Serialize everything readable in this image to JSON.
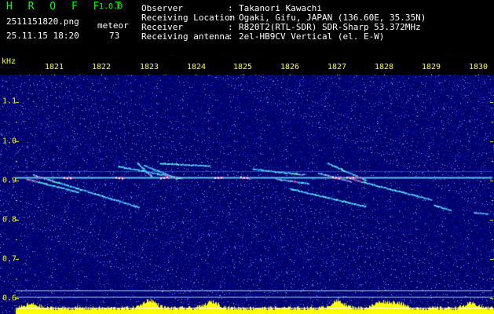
{
  "header": {
    "app_name": "H R O F F T",
    "app_version": "1.0.0",
    "filename": "2511151820.png",
    "datetime": "25.11.15 18:20",
    "count_label": "meteor",
    "count_value": "73"
  },
  "metadata": [
    {
      "label": "Observer",
      "value": "Takanori Kawachi"
    },
    {
      "label": "Receiving Location",
      "value": "Ogaki, Gifu, JAPAN (136.60E, 35.35N)"
    },
    {
      "label": "Receiver",
      "value": "R820T2(RTL-SDR) SDR-Sharp 53.372MHz"
    },
    {
      "label": "Receiving antenna",
      "value": "2el-HB9CV Vertical (el. E-W)"
    }
  ],
  "colors": {
    "label_text": "#ffffff",
    "axis_text": "#ffff00",
    "brand": "#00ff00",
    "background": "#000080",
    "carrier": "#66ffee",
    "peak": "#ff3399"
  },
  "chart_data": {
    "type": "heatmap",
    "ylabel": "kHz",
    "x_ticks": [
      "1821",
      "1822",
      "1823",
      "1824",
      "1825",
      "1826",
      "1827",
      "1828",
      "1829",
      "1830"
    ],
    "y_ticks": [
      "1.1",
      "1.0",
      "0.9",
      "0.8",
      "0.7",
      "0.6"
    ],
    "ylim": [
      0.58,
      1.17
    ],
    "xlim": [
      1820.5,
      1830.2
    ],
    "carrier_khz": 0.907,
    "meteor_traces": [
      {
        "t0": 1820.55,
        "f0": 0.915,
        "t1": 1822.8,
        "f1": 0.833
      },
      {
        "t0": 1820.4,
        "f0": 0.905,
        "t1": 1821.5,
        "f1": 0.872
      },
      {
        "t0": 1822.35,
        "f0": 0.937,
        "t1": 1823.7,
        "f1": 0.907
      },
      {
        "t0": 1822.75,
        "f0": 0.946,
        "t1": 1823.05,
        "f1": 0.913
      },
      {
        "t0": 1822.9,
        "f0": 0.94,
        "t1": 1823.6,
        "f1": 0.906
      },
      {
        "t0": 1823.25,
        "f0": 0.945,
        "t1": 1824.3,
        "f1": 0.938
      },
      {
        "t0": 1825.2,
        "f0": 0.93,
        "t1": 1826.3,
        "f1": 0.916
      },
      {
        "t0": 1825.7,
        "f0": 0.905,
        "t1": 1826.4,
        "f1": 0.893
      },
      {
        "t0": 1826.8,
        "f0": 0.945,
        "t1": 1827.6,
        "f1": 0.902
      },
      {
        "t0": 1826.6,
        "f0": 0.92,
        "t1": 1827.3,
        "f1": 0.898
      },
      {
        "t0": 1826.0,
        "f0": 0.88,
        "t1": 1827.6,
        "f1": 0.835
      },
      {
        "t0": 1827.3,
        "f0": 0.905,
        "t1": 1829.0,
        "f1": 0.852
      },
      {
        "t0": 1829.05,
        "f0": 0.838,
        "t1": 1829.4,
        "f1": 0.826
      },
      {
        "t0": 1829.9,
        "f0": 0.82,
        "t1": 1830.2,
        "f1": 0.816
      }
    ]
  }
}
